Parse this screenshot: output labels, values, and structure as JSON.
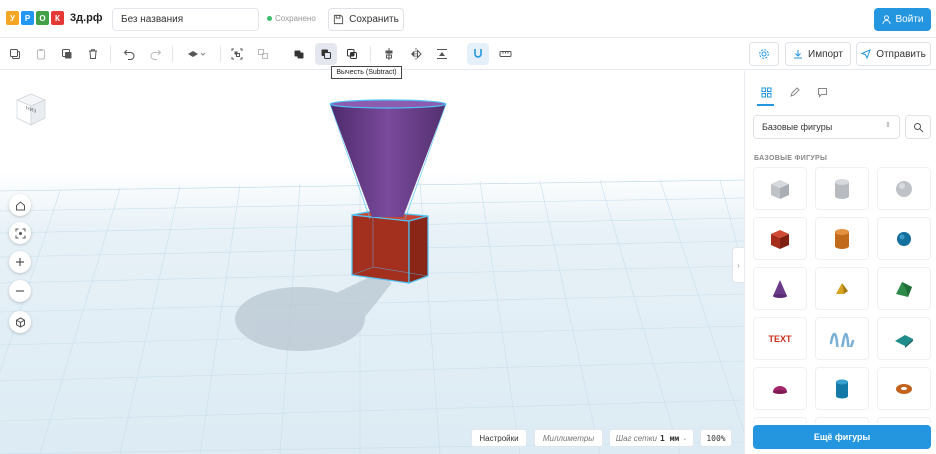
{
  "header": {
    "logo_letters": [
      "У",
      "Р",
      "О",
      "К"
    ],
    "logo_colors": [
      "#f5a623",
      "#2196f3",
      "#43a047",
      "#e53935"
    ],
    "brand": "3д.рф",
    "project_title": "Без названия",
    "saved_status": "Сохранено",
    "save_label": "Сохранить",
    "login_label": "Войти"
  },
  "toolbar": {
    "import_label": "Импорт",
    "send_label": "Отправить",
    "tooltip": "Вычесть (Subtract)"
  },
  "viewport": {
    "view_cube_label": "НИЗ",
    "settings_label": "Настройки",
    "units_label": "Миллиметры",
    "grid_step_label": "Шаг сетки",
    "grid_step_value": "1 мм",
    "zoom_label": "100%"
  },
  "panel": {
    "select_value": "Базовые фигуры",
    "section_title": "БАЗОВЫЕ ФИГУРЫ",
    "text_shape_label": "TEXT",
    "more_label": "Ещё фигуры"
  },
  "colors": {
    "accent": "#2496e0",
    "selection": "#4fc3f7",
    "cone": "#6a3a8a",
    "box": "#a0301e"
  }
}
